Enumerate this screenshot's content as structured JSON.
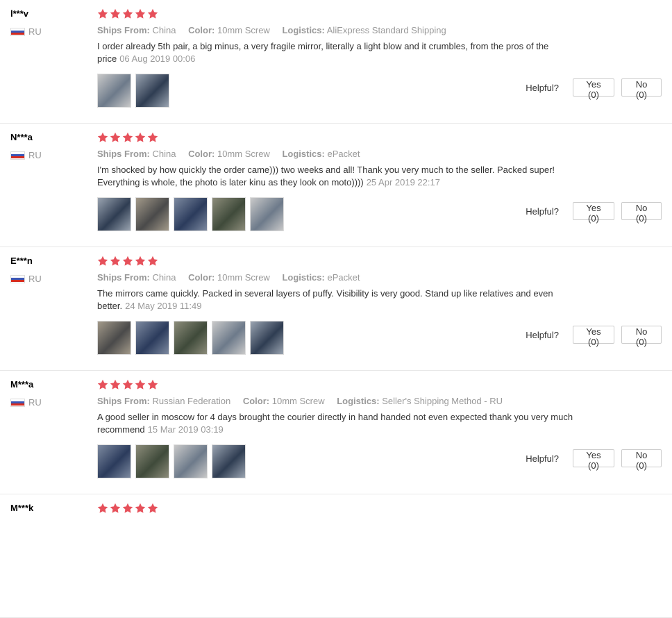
{
  "colors": {
    "star": "#e6505a",
    "muted": "#999999",
    "text": "#333333"
  },
  "labels": {
    "ships_from": "Ships From:",
    "color": "Color:",
    "logistics": "Logistics:",
    "helpful": "Helpful?"
  },
  "reviews": [
    {
      "user": "l***v",
      "country": "RU",
      "stars": 5,
      "ships_from": "China",
      "color": "10mm Screw",
      "logistics": "AliExpress Standard Shipping",
      "text": "I order already 5th pair, a big minus, a very fragile mirror, literally a light blow and it crumbles, from the pros of the price",
      "date": "06 Aug 2019 00:06",
      "photos": [
        "photo-1",
        "photo-2"
      ],
      "yes": "Yes (0)",
      "no": "No (0)"
    },
    {
      "user": "N***a",
      "country": "RU",
      "stars": 5,
      "ships_from": "China",
      "color": "10mm Screw",
      "logistics": "ePacket",
      "text": "I'm shocked by how quickly the order came))) two weeks and all! Thank you very much to the seller. Packed super! Everything is whole, the photo is later kinu as they look on moto))))",
      "date": "25 Apr 2019 22:17",
      "photos": [
        "photo-1",
        "photo-2",
        "photo-3",
        "photo-4",
        "photo-5"
      ],
      "yes": "Yes (0)",
      "no": "No (0)"
    },
    {
      "user": "E***n",
      "country": "RU",
      "stars": 5,
      "ships_from": "China",
      "color": "10mm Screw",
      "logistics": "ePacket",
      "text": "The mirrors came quickly. Packed in several layers of puffy. Visibility is very good. Stand up like relatives and even better.",
      "date": "24 May 2019 11:49",
      "photos": [
        "photo-1",
        "photo-2",
        "photo-3",
        "photo-4",
        "photo-5"
      ],
      "yes": "Yes (0)",
      "no": "No (0)"
    },
    {
      "user": "M***a",
      "country": "RU",
      "stars": 5,
      "ships_from": "Russian Federation",
      "color": "10mm Screw",
      "logistics": "Seller's Shipping Method - RU",
      "text": "A good seller in moscow for 4 days brought the courier directly in hand handed not even expected thank you very much recommend",
      "date": "15 Mar 2019 03:19",
      "photos": [
        "photo-1",
        "photo-2",
        "photo-3",
        "photo-4"
      ],
      "yes": "Yes (0)",
      "no": "No (0)"
    },
    {
      "user": "M***k",
      "country": "",
      "stars": 5,
      "ships_from": "",
      "color": "",
      "logistics": "",
      "text": "",
      "date": "",
      "photos": [],
      "yes": "",
      "no": ""
    }
  ]
}
